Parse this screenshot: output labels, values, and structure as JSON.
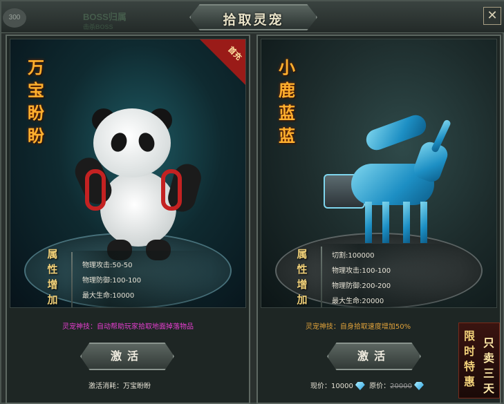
{
  "header": {
    "level_badge": "300",
    "boss_tab": "BOSS归属",
    "boss_tab_sub": "击杀BOSS",
    "title": "拾取灵宠",
    "close_label": "✕"
  },
  "pets": [
    {
      "name": "万宝盼盼",
      "badge": "首充",
      "attr_label": "属性增加",
      "stats": [
        "物理攻击:50-50",
        "物理防御:100-100",
        "最大生命:10000"
      ],
      "skill": "灵宠神技：自动帮助玩家拾取地面掉落物品",
      "button": "激活",
      "cost": "激活消耗：万宝盼盼"
    },
    {
      "name": "小鹿蓝蓝",
      "attr_label": "属性增加",
      "stats": [
        "切割:100000",
        "物理攻击:100-100",
        "物理防御:200-200",
        "最大生命:20000"
      ],
      "skill": "灵宠神技：自身拾取速度增加50%",
      "button": "激活",
      "price_now_label": "现价：",
      "price_now": "10000",
      "price_orig_label": "原价：",
      "price_orig": "20000",
      "promo_left": "限时特惠",
      "promo_right": "只卖三天"
    }
  ],
  "colors": {
    "skill_left": "#e53ecf",
    "skill_right": "#e0a23a",
    "name": "#ffb02e"
  }
}
